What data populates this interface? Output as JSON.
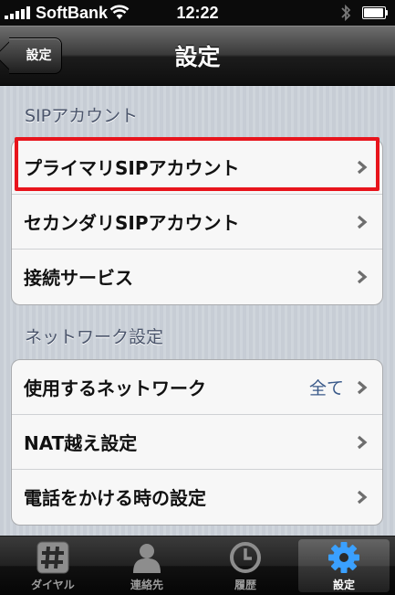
{
  "status_bar": {
    "carrier": "SoftBank",
    "time": "12:22"
  },
  "nav": {
    "back_label": "設定",
    "title": "設定"
  },
  "sections": [
    {
      "header": "SIPアカウント",
      "items": [
        {
          "label": "プライマリSIPアカウント",
          "value": ""
        },
        {
          "label": "セカンダリSIPアカウント",
          "value": ""
        },
        {
          "label": "接続サービス",
          "value": ""
        }
      ]
    },
    {
      "header": "ネットワーク設定",
      "items": [
        {
          "label": "使用するネットワーク",
          "value": "全て"
        },
        {
          "label": "NAT越え設定",
          "value": ""
        },
        {
          "label": "電話をかける時の設定",
          "value": ""
        }
      ]
    }
  ],
  "tabs": [
    {
      "label": "ダイヤル",
      "icon": "dialpad-icon",
      "selected": false
    },
    {
      "label": "連絡先",
      "icon": "contacts-icon",
      "selected": false
    },
    {
      "label": "履歴",
      "icon": "history-clock-icon",
      "selected": false
    },
    {
      "label": "設定",
      "icon": "settings-gear-icon",
      "selected": true
    }
  ],
  "colors": {
    "highlight": "#e8141c",
    "detail_value": "#3a5a8a",
    "section_header": "#4c566c"
  }
}
